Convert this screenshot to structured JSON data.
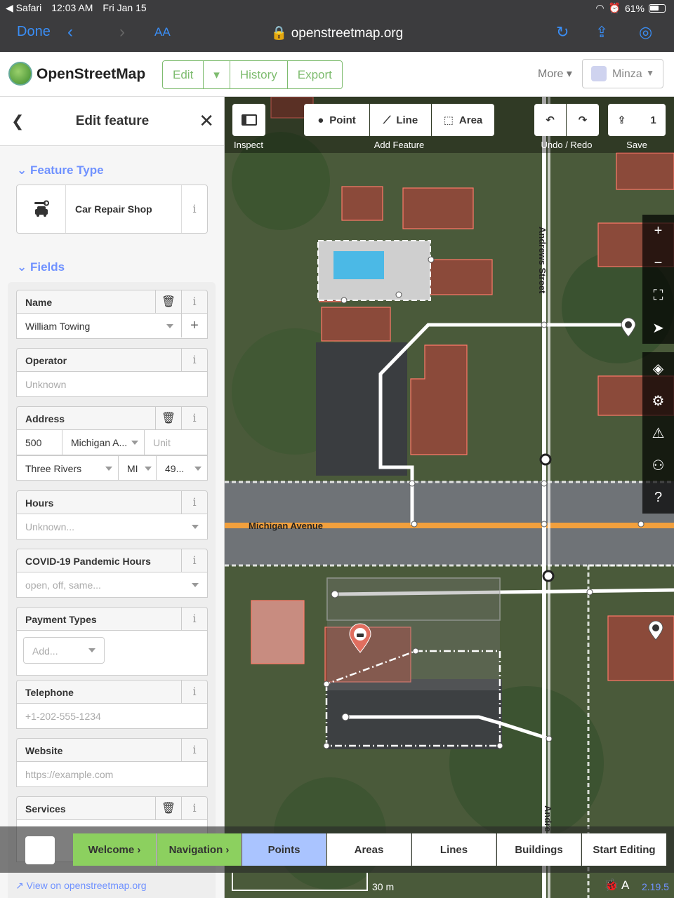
{
  "status": {
    "back_app": "◀ Safari",
    "time": "12:03 AM",
    "date": "Fri Jan 15",
    "battery": "61%"
  },
  "browser": {
    "done": "Done",
    "text_size": "AA",
    "url": "openstreetmap.org"
  },
  "header": {
    "brand": "OpenStreetMap",
    "tabs": [
      "Edit",
      "▾",
      "History",
      "Export"
    ],
    "more": "More ▾",
    "user": "Minza"
  },
  "sidebar": {
    "title": "Edit feature",
    "feature_type_heading": "Feature Type",
    "preset": "Car Repair Shop",
    "fields_heading": "Fields",
    "fields": {
      "name_label": "Name",
      "name_value": "William Towing",
      "operator_label": "Operator",
      "operator_ph": "Unknown",
      "address_label": "Address",
      "housenumber": "500",
      "street": "Michigan A...",
      "unit_ph": "Unit",
      "city": "Three Rivers",
      "state": "MI",
      "postcode": "49...",
      "hours_label": "Hours",
      "hours_ph": "Unknown...",
      "covid_label": "COVID-19 Pandemic Hours",
      "covid_ph": "open, off, same...",
      "payment_label": "Payment Types",
      "payment_ph": "Add...",
      "telephone_label": "Telephone",
      "telephone_ph": "+1-202-555-1234",
      "website_label": "Website",
      "website_ph": "https://example.com",
      "services_label": "Services"
    },
    "view_link": "View on openstreetmap.org"
  },
  "toolbar": {
    "inspect": "Inspect",
    "point": "Point",
    "line": "Line",
    "area": "Area",
    "add_feature": "Add Feature",
    "undo_redo": "Undo / Redo",
    "save_count": "1",
    "save": "Save"
  },
  "map": {
    "street_vertical": "Andrews Street",
    "street_horizontal": "Michigan Avenue",
    "street_bottom": "Andre"
  },
  "walkthrough": [
    "Welcome",
    "Navigation",
    "Points",
    "Areas",
    "Lines",
    "Buildings",
    "Start Editing"
  ],
  "footer": {
    "scale": "30 m",
    "version": "2.19.5"
  }
}
